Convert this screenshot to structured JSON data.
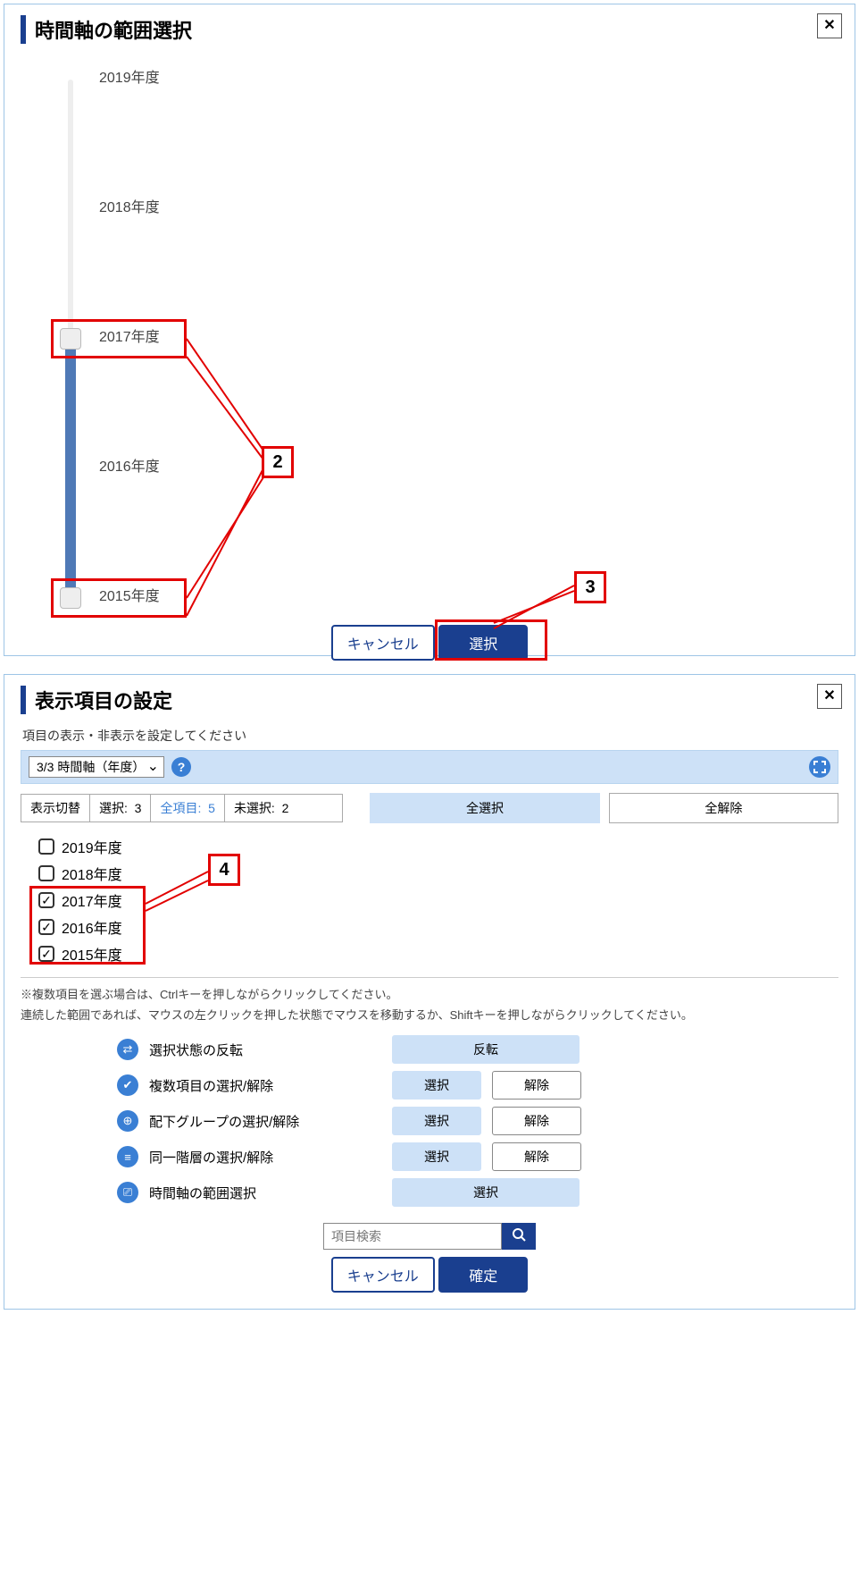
{
  "top": {
    "title": "時間軸の範囲選択",
    "ticks": [
      "2019年度",
      "2018年度",
      "2017年度",
      "2016年度",
      "2015年度"
    ],
    "cancel": "キャンセル",
    "select": "選択",
    "callout2": "2",
    "callout3": "3"
  },
  "bottom": {
    "title": "表示項目の設定",
    "subtitle": "項目の表示・非表示を設定してください",
    "axis_label": "3/3 時間軸（年度）",
    "toggle_label": "表示切替",
    "sel_label": "選択:",
    "sel_count": "3",
    "all_label": "全項目:",
    "all_count": "5",
    "unsel_label": "未選択:",
    "unsel_count": "2",
    "select_all": "全選択",
    "clear_all": "全解除",
    "items": [
      {
        "label": "2019年度",
        "checked": false
      },
      {
        "label": "2018年度",
        "checked": false
      },
      {
        "label": "2017年度",
        "checked": true
      },
      {
        "label": "2016年度",
        "checked": true
      },
      {
        "label": "2015年度",
        "checked": true
      }
    ],
    "callout4": "4",
    "note1": "※複数項目を選ぶ場合は、Ctrlキーを押しながらクリックしてください。",
    "note2": "連続した範囲であれば、マウスの左クリックを押した状態でマウスを移動するか、Shiftキーを押しながらクリックしてください。",
    "ops": [
      {
        "label": "選択状態の反転",
        "b1": "反転"
      },
      {
        "label": "複数項目の選択/解除",
        "b1": "選択",
        "b2": "解除"
      },
      {
        "label": "配下グループの選択/解除",
        "b1": "選択",
        "b2": "解除"
      },
      {
        "label": "同一階層の選択/解除",
        "b1": "選択",
        "b2": "解除"
      },
      {
        "label": "時間軸の範囲選択",
        "b1": "選択"
      }
    ],
    "search_ph": "項目検索",
    "cancel": "キャンセル",
    "confirm": "確定"
  }
}
